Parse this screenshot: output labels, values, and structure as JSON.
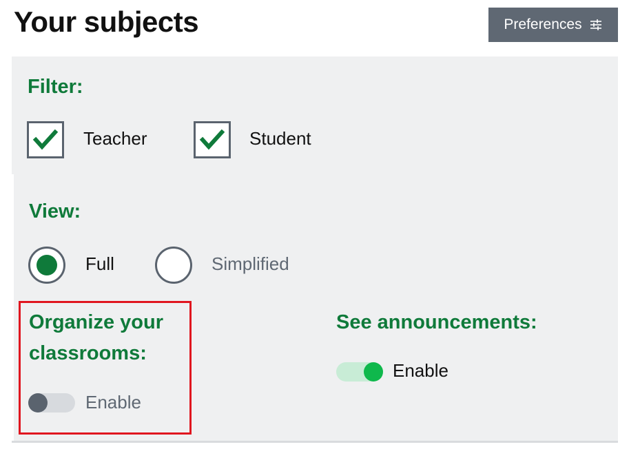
{
  "header": {
    "title": "Your subjects",
    "preferences_label": "Preferences",
    "preferences_icon": "sliders-icon"
  },
  "filter": {
    "label": "Filter:",
    "options": [
      {
        "label": "Teacher",
        "checked": true
      },
      {
        "label": "Student",
        "checked": true
      }
    ]
  },
  "view": {
    "label": "View:",
    "options": [
      {
        "label": "Full",
        "selected": true
      },
      {
        "label": "Simplified",
        "selected": false
      }
    ]
  },
  "organize": {
    "label_line1": "Organize your",
    "label_line2": "classrooms:",
    "toggle_label": "Enable",
    "enabled": false
  },
  "announcements": {
    "label": "See announcements:",
    "toggle_label": "Enable",
    "enabled": true
  },
  "colors": {
    "accent_green": "#0f7a3a",
    "toggle_on": "#0fb84c",
    "highlight_red": "#e0161f",
    "button_gray": "#5f6873"
  }
}
